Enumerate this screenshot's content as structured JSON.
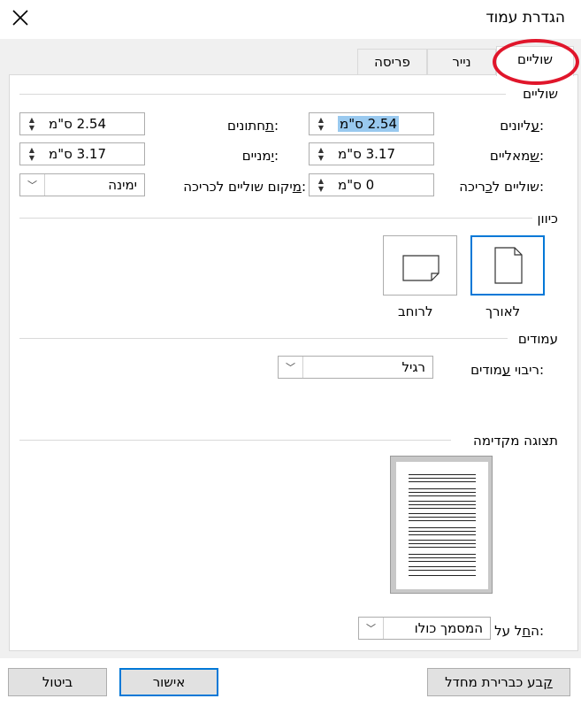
{
  "window": {
    "title": "הגדרת עמוד"
  },
  "tabs": [
    {
      "label": "שוליים",
      "active": true
    },
    {
      "label": "נייר",
      "active": false
    },
    {
      "label": "פריסה",
      "active": false
    }
  ],
  "margins": {
    "section_title": "שוליים",
    "top": {
      "label": "עליונים:",
      "value": "2.54 ס\"מ",
      "number": "2.54",
      "unit": "ס\"מ"
    },
    "bottom": {
      "label": "תחתונים:",
      "value": "2.54 ס\"מ"
    },
    "left": {
      "label": "שמאליים:",
      "value": "3.17 ס\"מ"
    },
    "right": {
      "label": "ימניים:",
      "value": "3.17 ס\"מ"
    },
    "gutter": {
      "label": "שוליים לכריכה:",
      "value": "0 ס\"מ"
    },
    "gutter_position": {
      "label": "מיקום שוליים לכריכה:",
      "value": "ימינה"
    }
  },
  "orientation": {
    "section_title": "כיוון",
    "portrait": {
      "label": "לאורך",
      "selected": true
    },
    "landscape": {
      "label": "לרוחב",
      "selected": false
    }
  },
  "pages": {
    "section_title": "עמודים",
    "multiple_pages": {
      "label": "ריבוי עמודים:",
      "value": "רגיל"
    }
  },
  "preview": {
    "section_title": "תצוגה מקדימה",
    "apply_to": {
      "label": "החל על:",
      "value": "המסמך כולו"
    }
  },
  "buttons": {
    "set_default": "קבע כברירת מחדל",
    "ok": "אישור",
    "cancel": "ביטול"
  },
  "colors": {
    "accent": "#0078d7",
    "annotation_ring": "#e0162b",
    "selection": "#99c9ef"
  }
}
